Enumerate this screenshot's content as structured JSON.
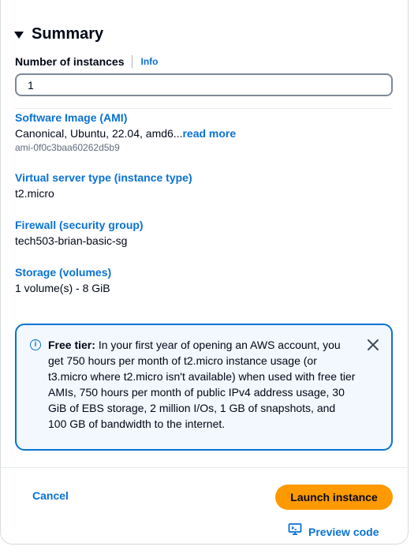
{
  "header": {
    "title": "Summary"
  },
  "instances": {
    "label": "Number of instances",
    "info": "Info",
    "value": "1"
  },
  "ami": {
    "title": "Software Image (AMI)",
    "value": "Canonical, Ubuntu, 22.04, amd6...",
    "read_more": "read more",
    "id": "ami-0f0c3baa60262d5b9"
  },
  "instance_type": {
    "title": "Virtual server type (instance type)",
    "value": "t2.micro"
  },
  "firewall": {
    "title": "Firewall (security group)",
    "value": "tech503-brian-basic-sg"
  },
  "storage": {
    "title": "Storage (volumes)",
    "value": "1 volume(s) - 8 GiB"
  },
  "free_tier": {
    "label": "Free tier:",
    "text": "In your first year of opening an AWS account, you get 750 hours per month of t2.micro instance usage (or t3.micro where t2.micro isn't available) when used with free tier AMIs, 750 hours per month of public IPv4 address usage, 30 GiB of EBS storage, 2 million I/Os, 1 GB of snapshots, and 100 GB of bandwidth to the internet."
  },
  "footer": {
    "cancel": "Cancel",
    "launch": "Launch instance",
    "preview": "Preview code"
  },
  "colors": {
    "link": "#0972d3",
    "primary_button": "#ff9900",
    "alert_bg": "#f2f8fd"
  }
}
